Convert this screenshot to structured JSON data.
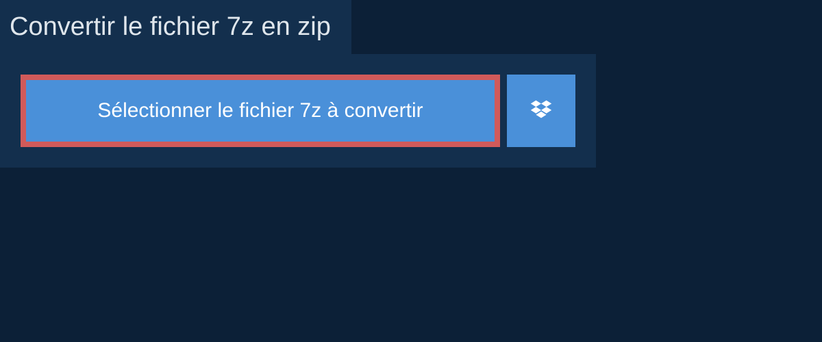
{
  "header": {
    "title": "Convertir le fichier 7z en zip"
  },
  "actions": {
    "select_file_label": "Sélectionner le fichier 7z à convertir"
  }
}
